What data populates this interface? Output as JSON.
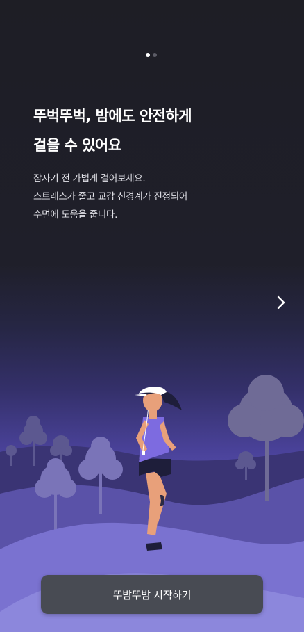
{
  "onboarding": {
    "page_indicator": {
      "current": 1,
      "total": 2
    },
    "title_lines": [
      "뚜벅뚜벅, 밤에도 안전하게",
      "걸을 수 있어요"
    ],
    "description_lines": [
      "잠자기 전 가볍게 걸어보세요.",
      "스트레스가 줄고 교감 신경계가 진정되어",
      "수면에 도움을 줍니다."
    ],
    "next_icon": "chevron-right-icon",
    "illustration": "night-running-woman-illustration"
  },
  "cta": {
    "start_label": "뚜밤뚜밤 시작하기"
  },
  "colors": {
    "background_top": "#1e1e25",
    "background_bottom": "#8b86e0",
    "button": "#484b53",
    "tree": "#6f6b96"
  }
}
